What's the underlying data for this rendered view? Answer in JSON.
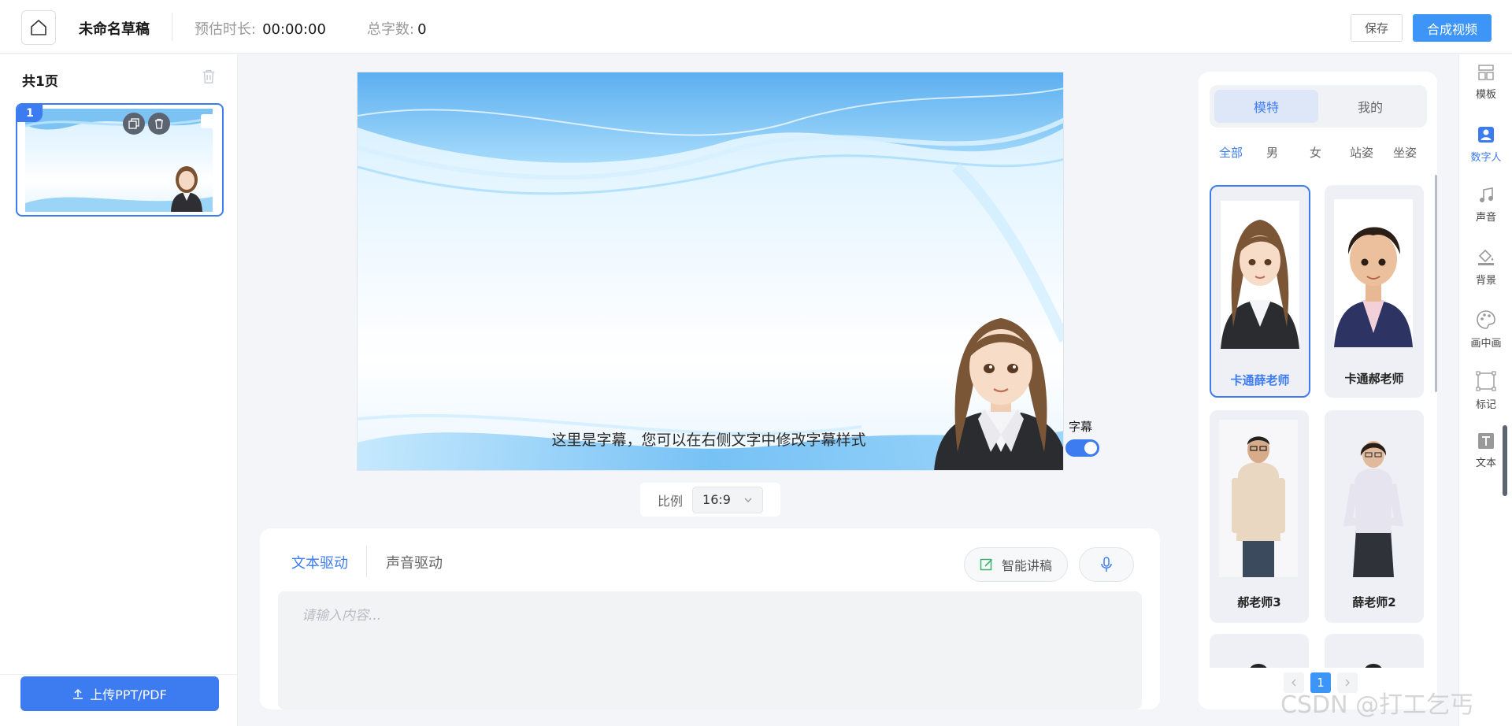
{
  "header": {
    "title": "未命名草稿",
    "duration_label": "预估时长:",
    "duration_value": "00:00:00",
    "wordcount_label": "总字数:",
    "wordcount_value": "0",
    "save_label": "保存",
    "compose_label": "合成视频"
  },
  "left": {
    "page_count": "共1页",
    "thumb_number": "1",
    "upload_label": "上传PPT/PDF"
  },
  "canvas": {
    "subtitle": "这里是字幕，您可以在右侧文字中修改字幕样式",
    "subtitle_toggle_label": "字幕",
    "ratio_label": "比例",
    "ratio_value": "16:9"
  },
  "editor": {
    "tab_text": "文本驱动",
    "tab_voice": "声音驱动",
    "smart_label": "智能讲稿",
    "placeholder": "请输入内容..."
  },
  "right": {
    "seg_model": "模特",
    "seg_mine": "我的",
    "filters": [
      "全部",
      "男",
      "女",
      "站姿",
      "坐姿"
    ],
    "cards": [
      "卡通薛老师",
      "卡通郝老师",
      "郝老师3",
      "薛老师2"
    ],
    "page": "1"
  },
  "toolbar": {
    "items": [
      "模板",
      "数字人",
      "声音",
      "背景",
      "画中画",
      "标记",
      "文本"
    ]
  },
  "colors": {
    "accent": "#3d7cf0",
    "button_blue": "#3d95f7"
  },
  "watermark": "CSDN @打工乞丐"
}
